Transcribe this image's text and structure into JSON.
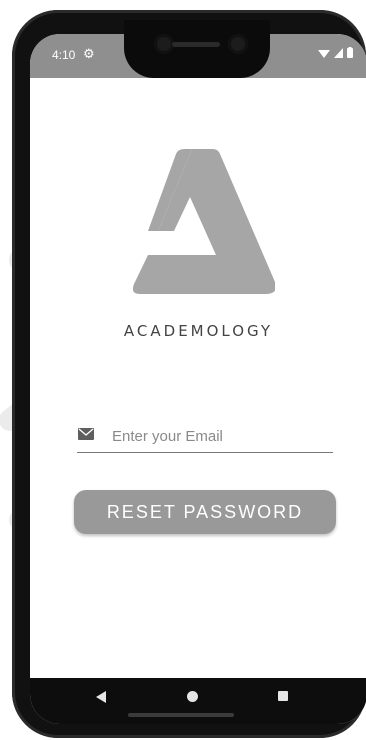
{
  "status_bar": {
    "time": "4:10",
    "settings_icon": "gear-icon",
    "wifi_icon": "wifi-icon",
    "signal_icon": "signal-icon",
    "battery_icon": "battery-icon"
  },
  "brand": {
    "name": "ACADEMOLOGY",
    "logo_icon": "academology-logo-icon"
  },
  "email": {
    "placeholder": "Enter your Email",
    "value": "",
    "icon": "mail-icon"
  },
  "reset_button": {
    "label": "RESET PASSWORD"
  },
  "nav_bar": {
    "back_icon": "back-triangle-icon",
    "home_icon": "home-circle-icon",
    "recents_icon": "recents-square-icon"
  },
  "colors": {
    "status_bar": "#8f8f8f",
    "button": "#999999",
    "logo": "#a6a6a6",
    "nav_bar": "#0d0d0d"
  }
}
